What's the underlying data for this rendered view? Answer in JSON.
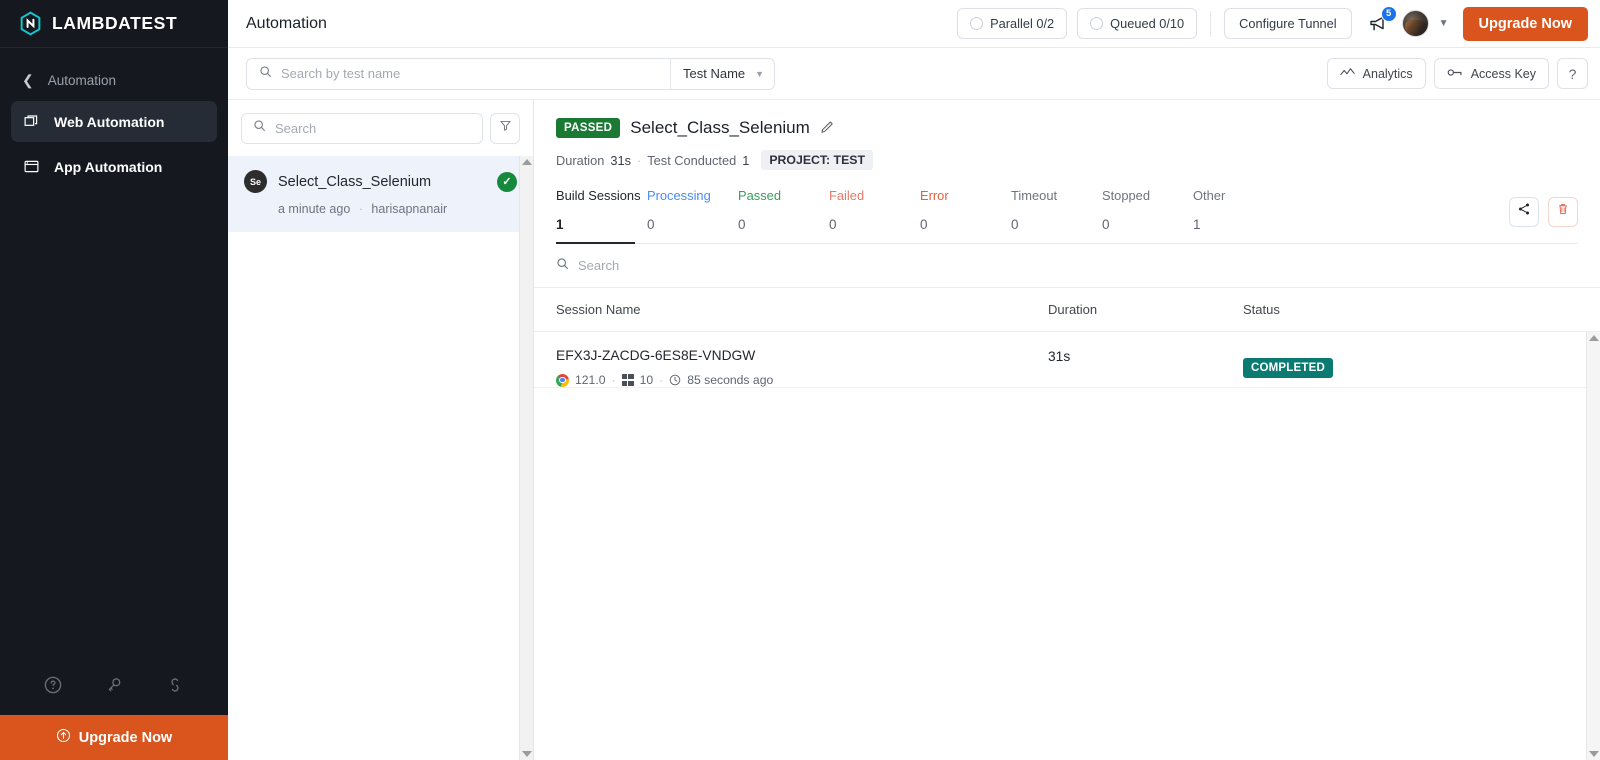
{
  "sidebar": {
    "logo_text": "LAMBDATEST",
    "back_label": "Automation",
    "items": [
      {
        "label": "Web Automation",
        "icon": "windows-stack-icon",
        "active": true
      },
      {
        "label": "App Automation",
        "icon": "app-window-icon",
        "active": false
      }
    ],
    "bottom_icons": [
      "help-circle-icon",
      "key-icon",
      "integrations-icon"
    ],
    "upgrade_label": "Upgrade Now"
  },
  "topbar": {
    "title": "Automation",
    "parallel_label": "Parallel 0/2",
    "queued_label": "Queued 0/10",
    "configure_tunnel_label": "Configure Tunnel",
    "notification_count": "5",
    "upgrade_label": "Upgrade Now",
    "accent_color": "#d9551d",
    "badge_color": "#1a73e8"
  },
  "searchrow": {
    "placeholder": "Search by test name",
    "value": "",
    "filter_select": "Test Name",
    "analytics_label": "Analytics",
    "access_key_label": "Access Key",
    "help_label": "?"
  },
  "listpanel": {
    "search_placeholder": "Search",
    "search_value": "",
    "items": [
      {
        "name": "Select_Class_Selenium",
        "framework_icon": "selenium-icon",
        "framework_short": "Se",
        "status_icon": "check-circle-icon",
        "time": "a minute ago",
        "user": "harisapnanair",
        "selected": true
      }
    ]
  },
  "detail": {
    "status_badge": "PASSED",
    "status_color": "#1a7a33",
    "title": "Select_Class_Selenium",
    "meta": {
      "duration_label": "Duration",
      "duration_value": "31s",
      "test_conducted_label": "Test Conducted",
      "test_conducted_value": "1",
      "project_chip": "PROJECT: TEST"
    },
    "tabs": [
      {
        "label": "Build Sessions",
        "value": "1",
        "color": "#22262d",
        "active": true
      },
      {
        "label": "Processing",
        "value": "0",
        "color": "#4a8df0",
        "active": false
      },
      {
        "label": "Passed",
        "value": "0",
        "color": "#3c9a5f",
        "active": false
      },
      {
        "label": "Failed",
        "value": "0",
        "color": "#e27a6a",
        "active": false
      },
      {
        "label": "Error",
        "value": "0",
        "color": "#e0623c",
        "active": false
      },
      {
        "label": "Timeout",
        "value": "0",
        "color": "#6f757e",
        "active": false
      },
      {
        "label": "Stopped",
        "value": "0",
        "color": "#6f757e",
        "active": false
      },
      {
        "label": "Other",
        "value": "1",
        "color": "#6f757e",
        "active": false
      }
    ],
    "actions": [
      {
        "name": "share-button",
        "icon": "share-icon"
      },
      {
        "name": "delete-button",
        "icon": "trash-icon"
      }
    ],
    "session_search_placeholder": "Search",
    "session_search_value": "",
    "table": {
      "columns": [
        "Session Name",
        "Duration",
        "Status"
      ],
      "rows": [
        {
          "session_name": "EFX3J-ZACDG-6ES8E-VNDGW",
          "browser_icon": "chrome-icon",
          "browser_version": "121.0",
          "os_icon": "windows-icon",
          "os_version": "10",
          "time_icon": "clock-icon",
          "time_ago": "85 seconds ago",
          "duration": "31s",
          "status": "COMPLETED",
          "status_color": "#0b7b72"
        }
      ]
    }
  }
}
